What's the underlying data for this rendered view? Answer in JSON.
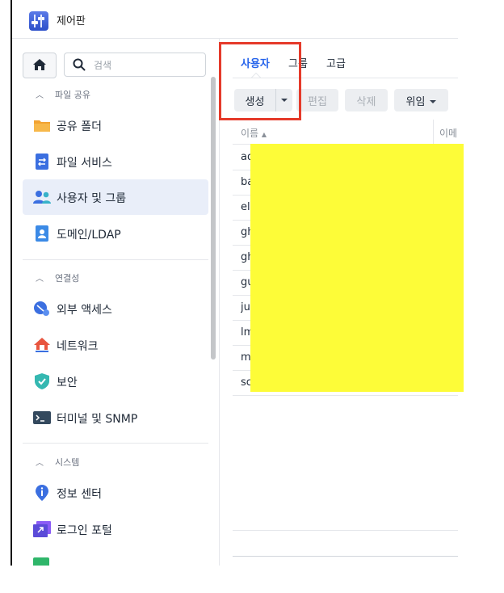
{
  "app": {
    "title": "제어판"
  },
  "search": {
    "placeholder": "검색"
  },
  "sidebar": {
    "sections": [
      {
        "label": "파일 공유"
      },
      {
        "label": "연결성"
      },
      {
        "label": "시스템"
      }
    ],
    "items": [
      {
        "label": "공유 폴더",
        "icon": "folder-icon"
      },
      {
        "label": "파일 서비스",
        "icon": "file-services-icon"
      },
      {
        "label": "사용자 및 그룹",
        "icon": "users-icon",
        "active": true
      },
      {
        "label": "도메인/LDAP",
        "icon": "domain-icon"
      },
      {
        "label": "외부 액세스",
        "icon": "external-access-icon"
      },
      {
        "label": "네트워크",
        "icon": "network-icon"
      },
      {
        "label": "보안",
        "icon": "shield-icon"
      },
      {
        "label": "터미널 및 SNMP",
        "icon": "terminal-icon"
      },
      {
        "label": "정보 센터",
        "icon": "info-icon"
      },
      {
        "label": "로그인 포털",
        "icon": "login-portal-icon"
      }
    ]
  },
  "tabs": [
    {
      "label": "사용자",
      "active": true
    },
    {
      "label": "그룹"
    },
    {
      "label": "고급"
    }
  ],
  "toolbar": {
    "create": "생성",
    "edit": "편집",
    "delete": "삭제",
    "delegate": "위임"
  },
  "table": {
    "columns": [
      "이름",
      "이메"
    ],
    "rows": [
      "ad",
      "ba",
      "el",
      "gh",
      "gh",
      "gu",
      "ju",
      "lm",
      "m",
      "sc"
    ]
  },
  "colors": {
    "accent": "#2563eb",
    "highlight": "#e53a2a",
    "redaction": "#fdfc38"
  }
}
